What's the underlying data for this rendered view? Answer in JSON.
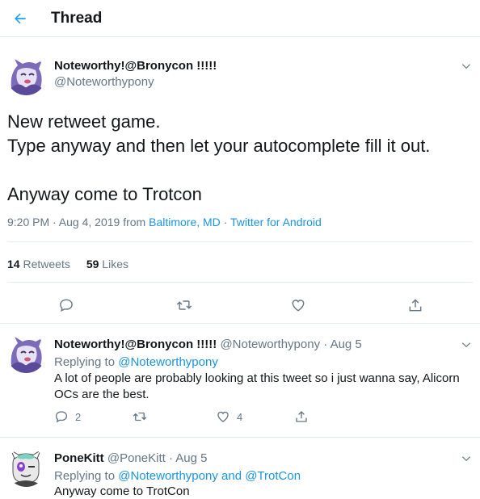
{
  "header": {
    "title": "Thread",
    "back_icon": "back-arrow-icon"
  },
  "main_tweet": {
    "display_name": "Noteworthy!@Bronycon !!!!!",
    "handle": "@Noteworthypony",
    "text": "New retweet game.\nType anyway and then let your autocomplete fill it out.\n\nAnyway come to Trotcon",
    "time": "9:20 PM · Aug 4, 2019",
    "from_label": "from",
    "location": "Baltimore, MD",
    "sep": "·",
    "source": "Twitter for Android",
    "retweets_count": "14",
    "retweets_label": "Retweets",
    "likes_count": "59",
    "likes_label": "Likes"
  },
  "replies": [
    {
      "display_name": "Noteworthy!@Bronycon !!!!!",
      "meta": "@Noteworthypony · Aug 5",
      "replying_label": "Replying to",
      "replying_to": "@Noteworthypony",
      "text": "A lot of people are probably looking at this tweet so i just wanna say, Alicorn OCs are the best.",
      "reply_count": "2",
      "retweet_count": "",
      "like_count": "4"
    },
    {
      "display_name": "PoneKitt",
      "meta": "@PoneKitt · Aug 5",
      "replying_label": "Replying to",
      "replying_to": "@Noteworthypony and @TrotCon",
      "text": "Anyway come to TrotCon"
    }
  ],
  "colors": {
    "accent": "#1da1f2",
    "link": "#1b95e0",
    "muted": "#657786",
    "border": "#e6ecf0",
    "text": "#14171a"
  }
}
